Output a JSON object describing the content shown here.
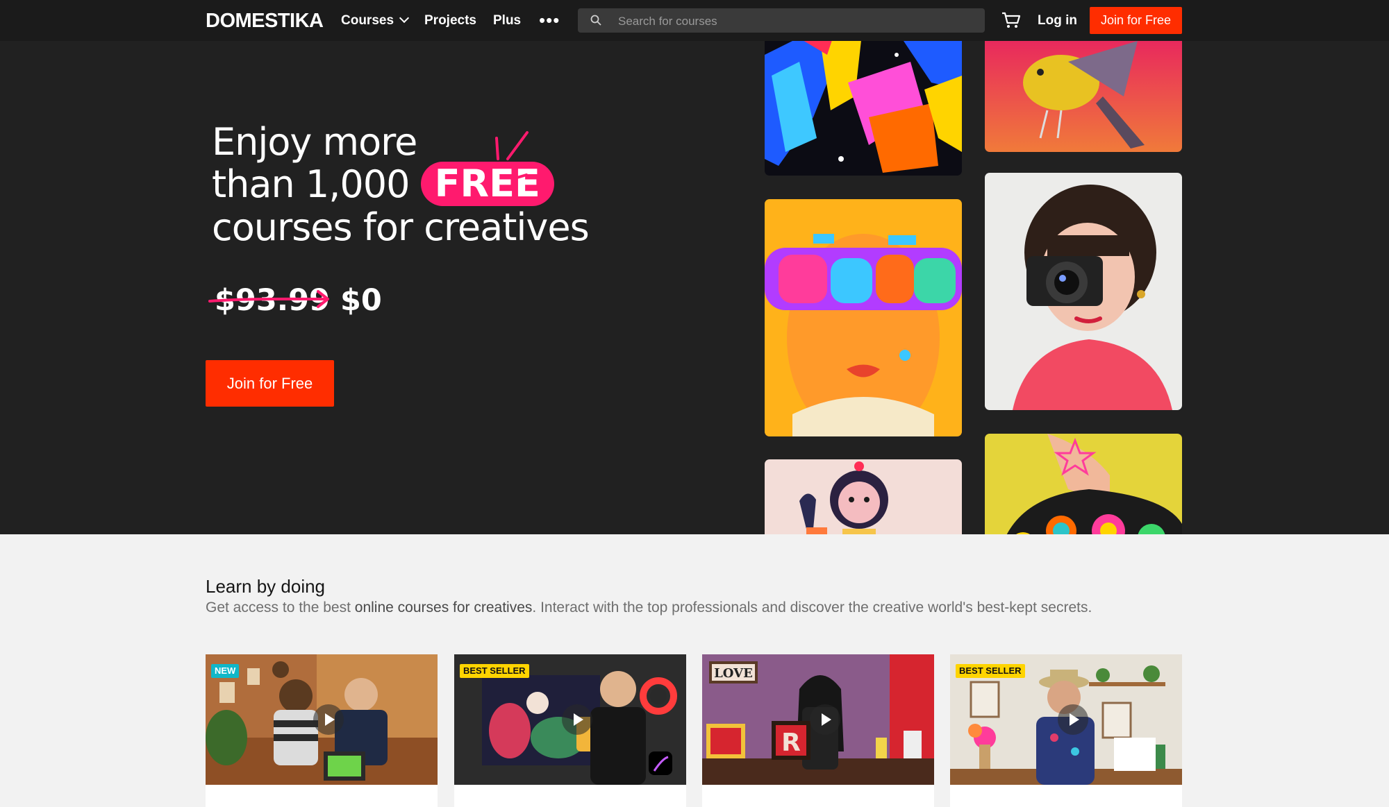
{
  "nav": {
    "logo": "DOMESTIKA",
    "courses": "Courses",
    "projects": "Projects",
    "plus": "Plus",
    "more": "•••",
    "search_placeholder": "Search for courses",
    "login": "Log in",
    "join": "Join for Free"
  },
  "hero": {
    "line1": "Enjoy more",
    "line2": "than 1,000",
    "pill": "FREE",
    "line3": "courses for creatives",
    "old_price": "$93.99",
    "new_price": "$0",
    "cta": "Join for Free"
  },
  "section": {
    "title": "Learn by doing",
    "desc_start": "Get access to the best ",
    "desc_bold": "online courses for creatives",
    "desc_end": ". Interact with the top professionals and discover the creative world's best-kept secrets."
  },
  "cards": [
    {
      "badge": "NEW"
    },
    {
      "badge": "BEST SELLER"
    },
    {
      "sign": "LOVE",
      "letter": "R"
    },
    {
      "badge": "BEST SELLER"
    }
  ],
  "colors": {
    "accent_red": "#ff2d00",
    "pill_pink": "#ff1a6e",
    "hero_bg": "#212121",
    "nav_bg": "#1b1b1b"
  }
}
